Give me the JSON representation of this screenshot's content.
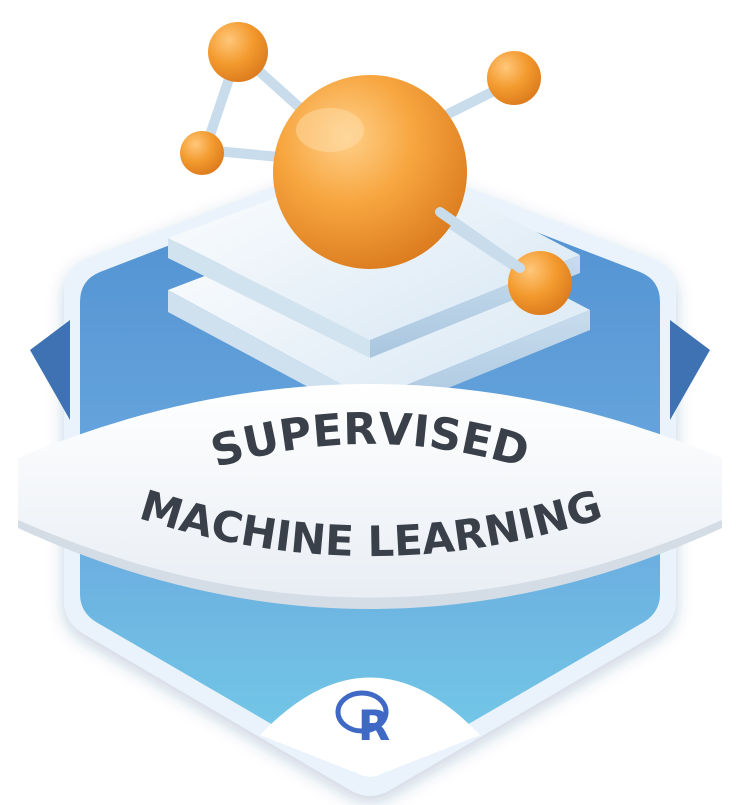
{
  "badge": {
    "title_line1": "SUPERVISED",
    "title_line2": "MACHINE LEARNING",
    "logo_letter": "R"
  },
  "colors": {
    "hex_top": "#5b9bd8",
    "hex_bottom": "#6ec6e6",
    "hex_outline": "#eaf3fb",
    "sphere": "#f39a2e",
    "sphere_highlight": "#ffd08a",
    "plate": "#e9f2f9",
    "banner": "#f5f8fb",
    "banner_text": "#3a4049",
    "r_logo": "#3f69c4"
  },
  "icons": [
    "network-node-icon",
    "stacked-layers-icon",
    "r-logo-icon"
  ]
}
